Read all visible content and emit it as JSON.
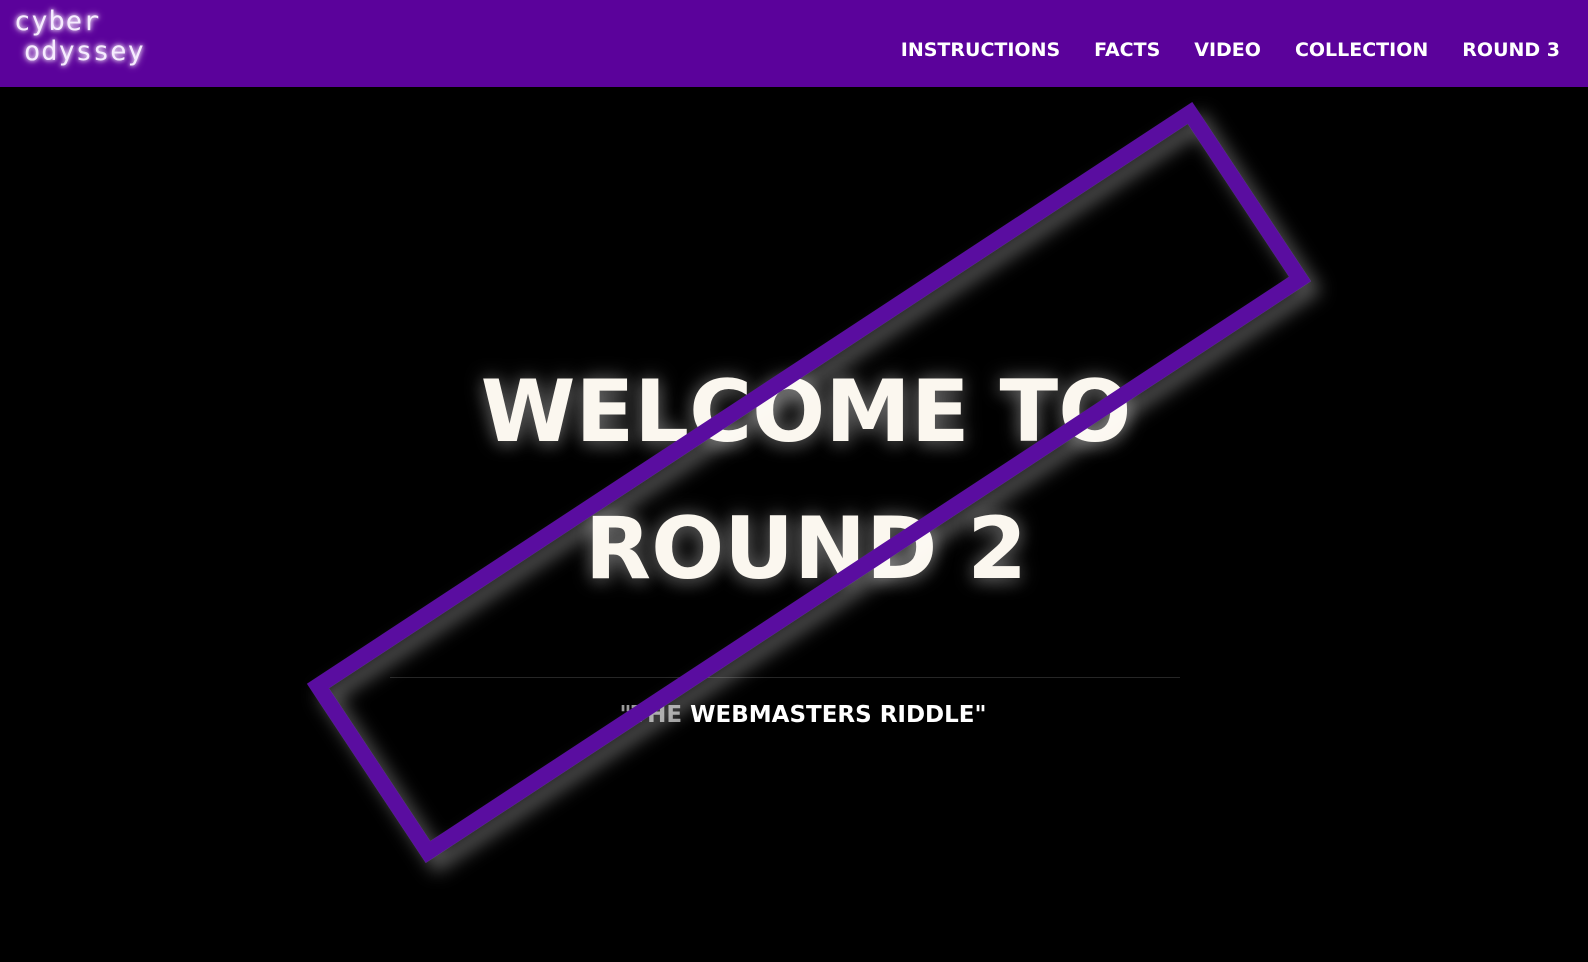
{
  "navbar": {
    "logo_line1": "cyber",
    "logo_line2": "odyssey",
    "links": [
      {
        "label": "INSTRUCTIONS"
      },
      {
        "label": "FACTS"
      },
      {
        "label": "VIDEO"
      },
      {
        "label": "COLLECTION"
      },
      {
        "label": "ROUND 3"
      }
    ]
  },
  "hero": {
    "headline_line1": "WELCOME TO",
    "headline_line2": "ROUND 2",
    "subtitle_quote_open": "\"THE",
    "subtitle_rest": " WEBMASTERS RIDDLE\""
  },
  "colors": {
    "nav_background": "#5b029b",
    "frame_stroke": "#5a0aa0",
    "page_background": "#000000",
    "headline_text": "#fbf7ef"
  }
}
